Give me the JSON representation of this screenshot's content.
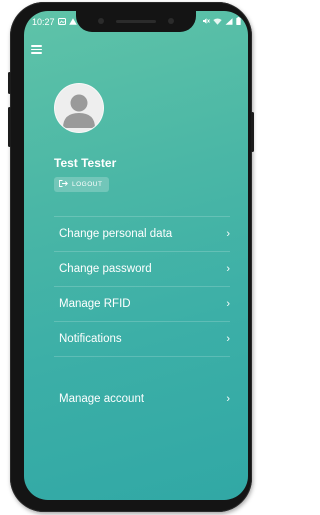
{
  "status_bar": {
    "time": "10:27",
    "left_icons": [
      "image-icon",
      "warning-icon",
      "notification-dot-icon"
    ],
    "right_icons": [
      "mute-icon",
      "wifi-icon",
      "signal-icon",
      "battery-icon"
    ]
  },
  "header": {
    "menu_icon": "hamburger-icon"
  },
  "profile": {
    "avatar_icon": "user-avatar-icon",
    "name": "Test Tester",
    "logout_label": "LOGOUT",
    "logout_icon": "logout-icon"
  },
  "menu": {
    "items": [
      {
        "label": "Change personal data",
        "icon": "chevron-right-icon"
      },
      {
        "label": "Change password",
        "icon": "chevron-right-icon"
      },
      {
        "label": "Manage RFID",
        "icon": "chevron-right-icon"
      },
      {
        "label": "Notifications",
        "icon": "chevron-right-icon"
      }
    ]
  },
  "account": {
    "label": "Manage account",
    "icon": "chevron-right-icon"
  },
  "colors": {
    "gradient_top": "#5fc3a8",
    "gradient_bottom": "#31a8a5",
    "text": "#ffffff",
    "phone_frame": "#141414"
  }
}
